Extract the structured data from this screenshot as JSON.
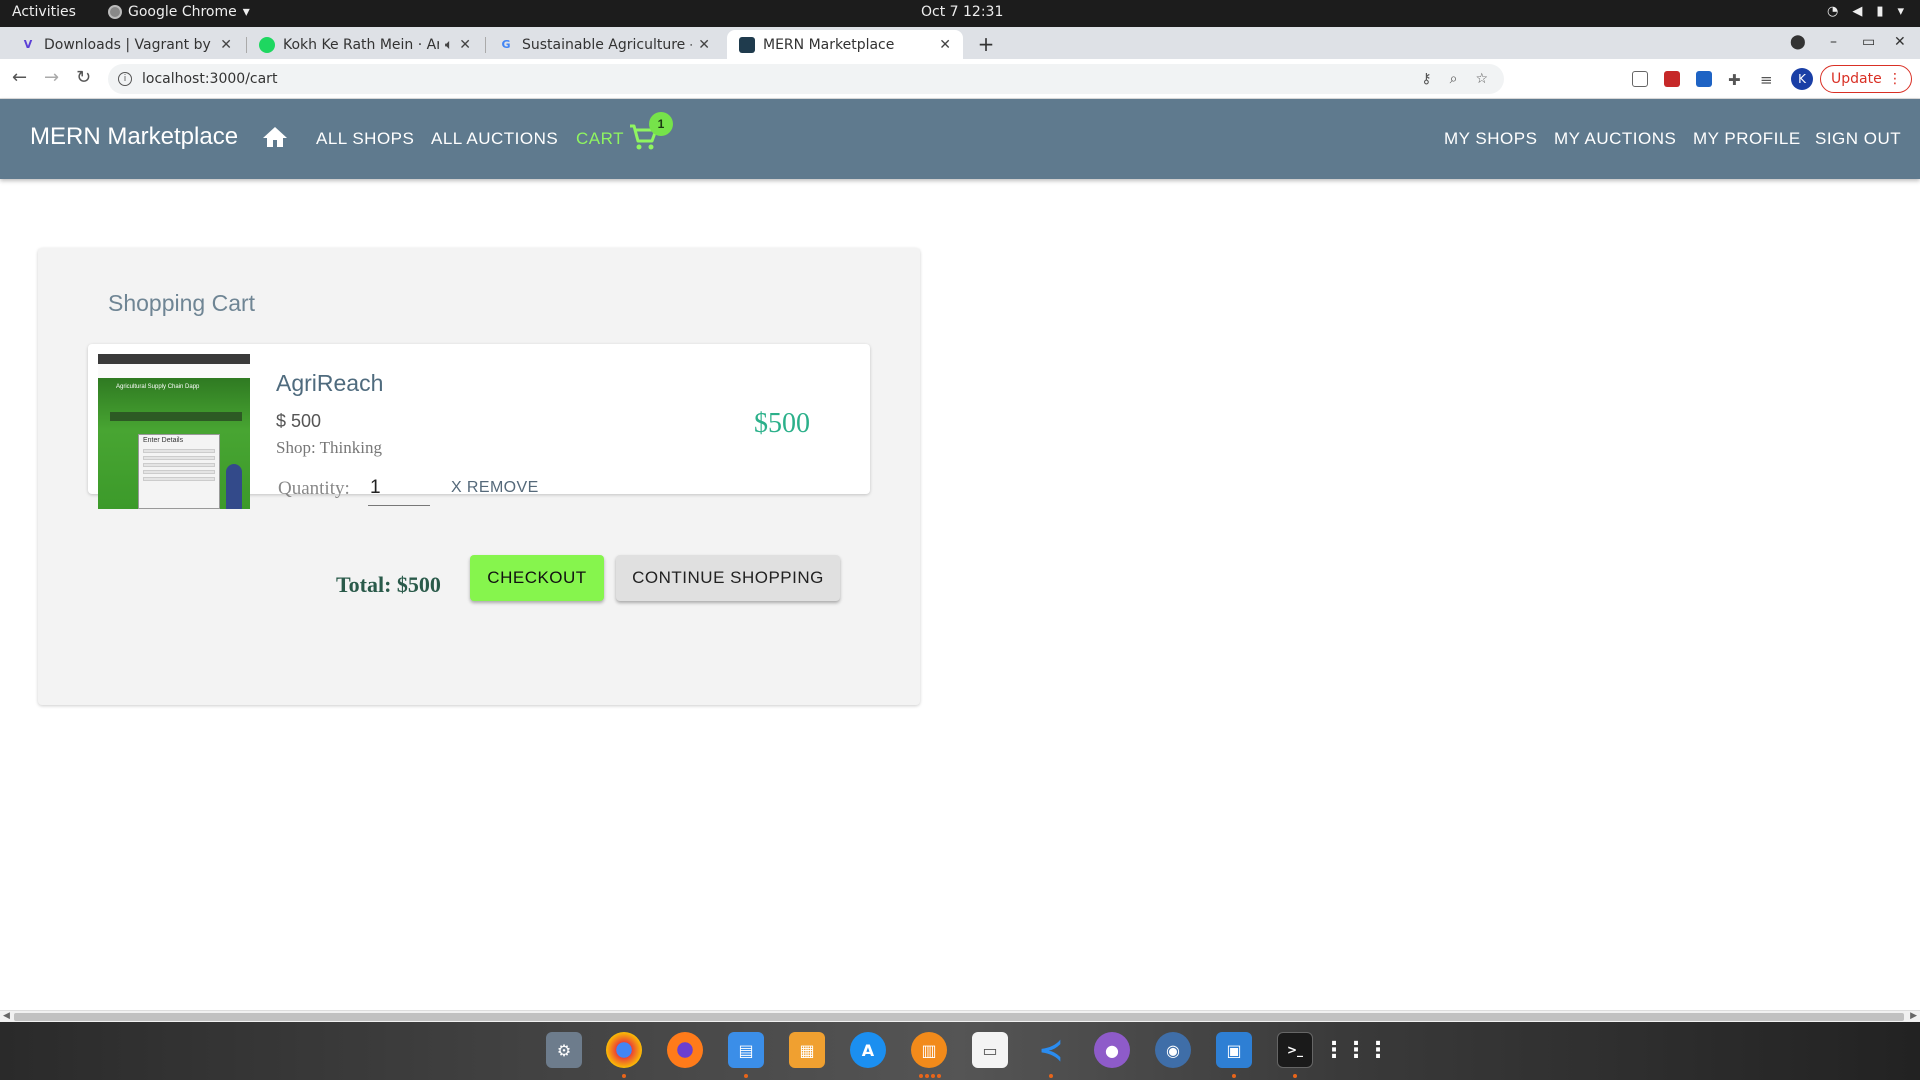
{
  "system_bar": {
    "activities": "Activities",
    "app_name": "Google Chrome",
    "clock": "Oct 7  12:31"
  },
  "browser": {
    "tabs": [
      {
        "title": "Downloads | Vagrant by H",
        "active": false
      },
      {
        "title": "Kokh Ke Rath Mein · Ar",
        "active": false
      },
      {
        "title": "Sustainable Agriculture - ",
        "active": false
      },
      {
        "title": "MERN Marketplace",
        "active": true
      }
    ],
    "url": "localhost:3000/cart",
    "profile_initial": "K",
    "update_label": "Update"
  },
  "appbar": {
    "brand": "MERN Marketplace",
    "nav_left": [
      "ALL SHOPS",
      "ALL AUCTIONS"
    ],
    "cart_label": "CART",
    "cart_count": "1",
    "nav_right": [
      "MY SHOPS",
      "MY AUCTIONS",
      "MY PROFILE",
      "SIGN OUT"
    ]
  },
  "cart": {
    "title": "Shopping Cart",
    "item": {
      "thumbnail_header": "Agricultural Supply Chain Dapp",
      "thumbnail_form_title": "Enter Details",
      "name": "AgriReach",
      "price": "$ 500",
      "shop": "Shop: Thinking",
      "quantity_label": "Quantity:",
      "quantity": "1",
      "remove_label": "X REMOVE",
      "line_total": "$500"
    },
    "total": "Total: $500",
    "checkout_label": "CHECKOUT",
    "continue_label": "CONTINUE SHOPPING"
  },
  "colors": {
    "appbar": "#5f7a8e",
    "cart_active": "#8ff560",
    "checkout": "#86f54d",
    "line_total": "#2bb08a"
  },
  "dock": {
    "apps": [
      "settings-icon",
      "chrome-icon",
      "firefox-icon",
      "files-icon",
      "store-icon",
      "appstore-icon",
      "books-icon",
      "text-editor-icon",
      "vscode-icon",
      "github-icon",
      "postgres-icon",
      "monitor-icon",
      "terminal-icon",
      "app-grid-icon"
    ]
  }
}
